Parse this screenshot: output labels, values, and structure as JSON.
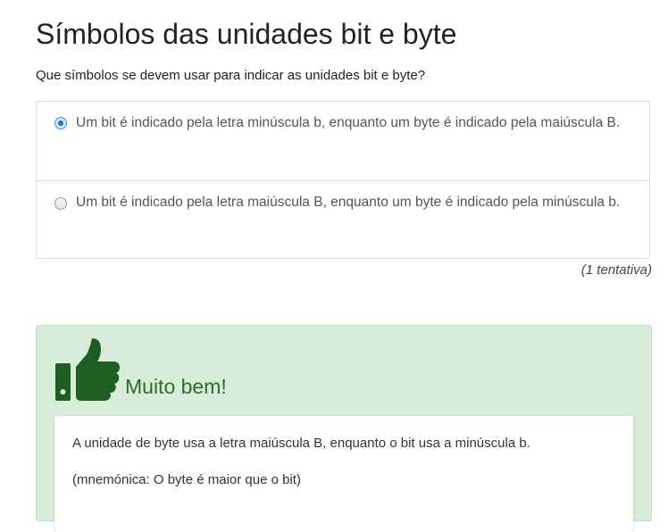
{
  "page": {
    "title": "Símbolos das unidades bit e byte",
    "question": "Que símbolos se devem usar para indicar as unidades bit e byte?"
  },
  "options": [
    {
      "text": "Um bit é indicado pela letra minúscula b, enquanto um byte é indicado pela maiúscula B.",
      "selected": true
    },
    {
      "text": "Um bit é indicado pela letra maiúscula B, enquanto um byte é indicado pela minúscula b.",
      "selected": false
    }
  ],
  "attempts": "(1 tentativa)",
  "feedback": {
    "icon": "thumbs-up-icon",
    "title": "Muito bem!",
    "lines": [
      "A unidade de byte usa a letra maiúscula B, enquanto o bit usa a minúscula b.",
      "(mnemónica: O byte é maior que o bit)"
    ]
  },
  "colors": {
    "accent_green": "#1e5e22",
    "feedback_bg": "#d8edd9",
    "radio_selected": "#1f6fcf"
  }
}
